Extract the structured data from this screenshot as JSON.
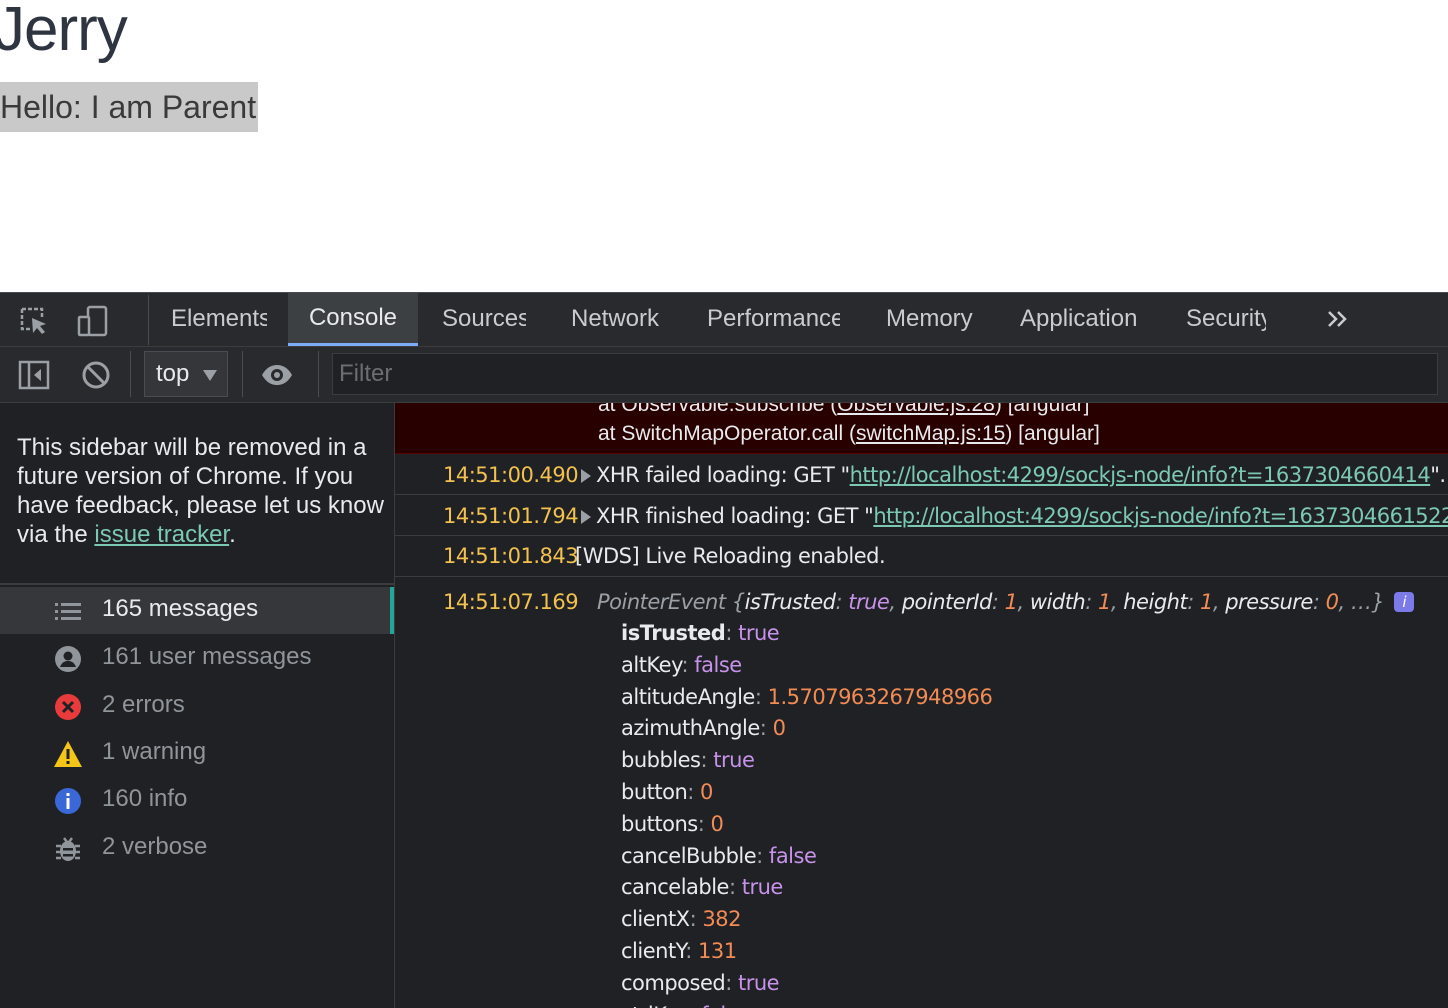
{
  "page": {
    "title": "Jerry",
    "hello": "Hello: I am Parent"
  },
  "devtools": {
    "tabs": [
      "Elements",
      "Console",
      "Sources",
      "Network",
      "Performance",
      "Memory",
      "Application",
      "Security"
    ],
    "active_tab": "Console",
    "more_tabs_icon": "double-chevron-right-icon",
    "context": "top",
    "filter_placeholder": "Filter",
    "sidebar": {
      "notice_prefix": "This sidebar will be removed in a future version of Chrome. If you have feedback, please let us know via the ",
      "notice_link": "issue tracker",
      "notice_suffix": ".",
      "items": [
        {
          "label": "165 messages",
          "icon": "list-icon"
        },
        {
          "label": "161 user messages",
          "icon": "user-icon"
        },
        {
          "label": "2 errors",
          "icon": "error-icon"
        },
        {
          "label": "1 warning",
          "icon": "warning-icon"
        },
        {
          "label": "160 info",
          "icon": "info-icon"
        },
        {
          "label": "2 verbose",
          "icon": "bug-icon"
        }
      ]
    },
    "console": {
      "error_stack": [
        {
          "prefix": "at Observable.subscribe (",
          "link": "Observable.js:28",
          "suffix": ") [angular]"
        },
        {
          "prefix": "at SwitchMapOperator.call (",
          "link": "switchMap.js:15",
          "suffix": ") [angular]"
        }
      ],
      "logs": [
        {
          "time": "14:51:00.490",
          "prefix": "XHR failed loading: GET \"",
          "link": "http://localhost:4299/sockjs-node/info?t=1637304660414",
          "suffix": "\"."
        },
        {
          "time": "14:51:01.794",
          "prefix": "XHR finished loading: GET \"",
          "link": "http://localhost:4299/sockjs-node/info?t=1637304661522",
          "suffix": "\"."
        },
        {
          "time": "14:51:01.843",
          "text": "[WDS] Live Reloading enabled."
        }
      ],
      "event": {
        "time": "14:51:07.169",
        "class_name": "PointerEvent",
        "summary": [
          {
            "key": "isTrusted",
            "value": "true",
            "kind": "bool"
          },
          {
            "key": "pointerId",
            "value": "1",
            "kind": "num"
          },
          {
            "key": "width",
            "value": "1",
            "kind": "num"
          },
          {
            "key": "height",
            "value": "1",
            "kind": "num"
          },
          {
            "key": "pressure",
            "value": "0",
            "kind": "num"
          }
        ],
        "ellipsis": "…",
        "properties": [
          {
            "key": "isTrusted",
            "value": "true",
            "kind": "bool",
            "bold": true
          },
          {
            "key": "altKey",
            "value": "false",
            "kind": "bool"
          },
          {
            "key": "altitudeAngle",
            "value": "1.5707963267948966",
            "kind": "num"
          },
          {
            "key": "azimuthAngle",
            "value": "0",
            "kind": "num"
          },
          {
            "key": "bubbles",
            "value": "true",
            "kind": "bool"
          },
          {
            "key": "button",
            "value": "0",
            "kind": "num"
          },
          {
            "key": "buttons",
            "value": "0",
            "kind": "num"
          },
          {
            "key": "cancelBubble",
            "value": "false",
            "kind": "bool"
          },
          {
            "key": "cancelable",
            "value": "true",
            "kind": "bool"
          },
          {
            "key": "clientX",
            "value": "382",
            "kind": "num"
          },
          {
            "key": "clientY",
            "value": "131",
            "kind": "num"
          },
          {
            "key": "composed",
            "value": "true",
            "kind": "bool"
          },
          {
            "key": "ctrlKey",
            "value": "false",
            "kind": "bool"
          }
        ]
      }
    }
  }
}
